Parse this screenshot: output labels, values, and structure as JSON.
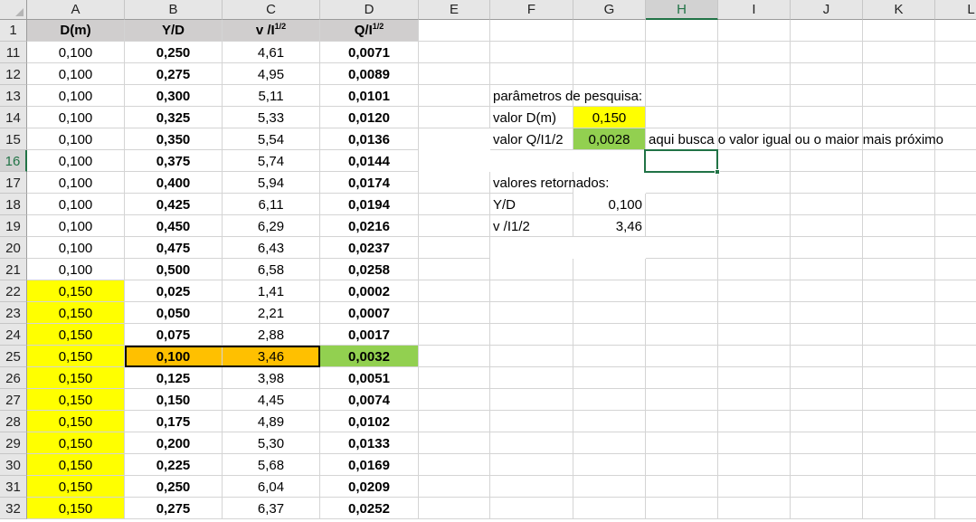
{
  "columns": [
    "A",
    "B",
    "C",
    "D",
    "E",
    "F",
    "G",
    "H",
    "I",
    "J",
    "K",
    "L"
  ],
  "selected_column": "H",
  "selected_row": "16",
  "header_row": {
    "row_number": "1",
    "cells": [
      "D(m)",
      "Y/D",
      "v  /I",
      "Q/I"
    ],
    "superscript": "1/2"
  },
  "rows": [
    {
      "n": "11",
      "a": "0,100",
      "b": "0,250",
      "c": "4,61",
      "d": "0,0071"
    },
    {
      "n": "12",
      "a": "0,100",
      "b": "0,275",
      "c": "4,95",
      "d": "0,0089"
    },
    {
      "n": "13",
      "a": "0,100",
      "b": "0,300",
      "c": "5,11",
      "d": "0,0101"
    },
    {
      "n": "14",
      "a": "0,100",
      "b": "0,325",
      "c": "5,33",
      "d": "0,0120"
    },
    {
      "n": "15",
      "a": "0,100",
      "b": "0,350",
      "c": "5,54",
      "d": "0,0136"
    },
    {
      "n": "16",
      "a": "0,100",
      "b": "0,375",
      "c": "5,74",
      "d": "0,0144"
    },
    {
      "n": "17",
      "a": "0,100",
      "b": "0,400",
      "c": "5,94",
      "d": "0,0174"
    },
    {
      "n": "18",
      "a": "0,100",
      "b": "0,425",
      "c": "6,11",
      "d": "0,0194"
    },
    {
      "n": "19",
      "a": "0,100",
      "b": "0,450",
      "c": "6,29",
      "d": "0,0216"
    },
    {
      "n": "20",
      "a": "0,100",
      "b": "0,475",
      "c": "6,43",
      "d": "0,0237"
    },
    {
      "n": "21",
      "a": "0,100",
      "b": "0,500",
      "c": "6,58",
      "d": "0,0258"
    },
    {
      "n": "22",
      "a": "0,150",
      "b": "0,025",
      "c": "1,41",
      "d": "0,0002"
    },
    {
      "n": "23",
      "a": "0,150",
      "b": "0,050",
      "c": "2,21",
      "d": "0,0007"
    },
    {
      "n": "24",
      "a": "0,150",
      "b": "0,075",
      "c": "2,88",
      "d": "0,0017"
    },
    {
      "n": "25",
      "a": "0,150",
      "b": "0,100",
      "c": "3,46",
      "d": "0,0032"
    },
    {
      "n": "26",
      "a": "0,150",
      "b": "0,125",
      "c": "3,98",
      "d": "0,0051"
    },
    {
      "n": "27",
      "a": "0,150",
      "b": "0,150",
      "c": "4,45",
      "d": "0,0074"
    },
    {
      "n": "28",
      "a": "0,150",
      "b": "0,175",
      "c": "4,89",
      "d": "0,0102"
    },
    {
      "n": "29",
      "a": "0,150",
      "b": "0,200",
      "c": "5,30",
      "d": "0,0133"
    },
    {
      "n": "30",
      "a": "0,150",
      "b": "0,225",
      "c": "5,68",
      "d": "0,0169"
    },
    {
      "n": "31",
      "a": "0,150",
      "b": "0,250",
      "c": "6,04",
      "d": "0,0209"
    },
    {
      "n": "32",
      "a": "0,150",
      "b": "0,275",
      "c": "6,37",
      "d": "0,0252"
    }
  ],
  "highlighted_row": "25",
  "search": {
    "params_title": "parâmetros de pesquisa:",
    "d_label": "valor D(m)",
    "d_value": "0,150",
    "q_label": "valor Q/I1/2",
    "q_value": "0,0028",
    "note": "aqui busca o valor igual ou o maior mais próximo",
    "returned_title": "valores retornados:",
    "yd_label": "Y/D",
    "yd_value": "0,100",
    "v_label": "v  /I1/2",
    "v_value": "3,46"
  },
  "colors": {
    "yellow": "#ffff00",
    "orange": "#ffc000",
    "green": "#92d050",
    "header_gray": "#d0cece",
    "selection": "#217346"
  }
}
